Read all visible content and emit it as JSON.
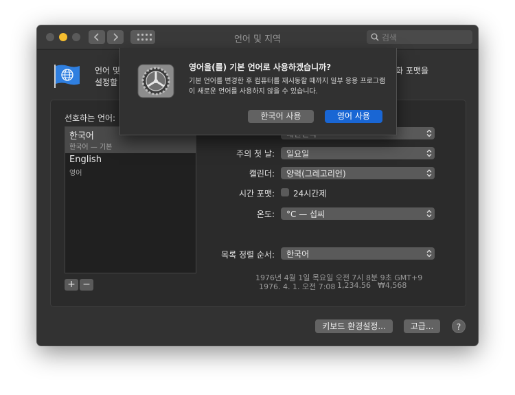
{
  "window": {
    "title": "언어 및 지역",
    "search_placeholder": "검색"
  },
  "intro": {
    "line1_left": "언어 및",
    "line1_right": "통화 포맷을",
    "line2_left": "설정할"
  },
  "preferred_languages": {
    "label": "선호하는 언어:",
    "items": [
      {
        "name": "한국어",
        "sub": "한국어 — 기본"
      },
      {
        "name": "English",
        "sub": "영어"
      }
    ],
    "add": "+",
    "remove": "−"
  },
  "settings": {
    "region_value": "대한민국",
    "first_day_label": "주의 첫 날:",
    "first_day_value": "일요일",
    "calendar_label": "캘린더:",
    "calendar_value": "양력(그레고리언)",
    "time_format_label": "시간 포맷:",
    "time_format_check": "24시간제",
    "temperature_label": "온도:",
    "temperature_value": "°C — 섭씨",
    "list_sort_label": "목록 정렬 순서:",
    "list_sort_value": "한국어"
  },
  "sample": {
    "line1": "1976년 4월 1일 목요일 오전 7시 8분 9초 GMT+9",
    "line2_date": "1976. 4. 1. 오전 7:08",
    "line2_number": "1,234.56",
    "line2_currency": "₩4,568"
  },
  "buttons": {
    "keyboard": "키보드 환경설정...",
    "advanced": "고급...",
    "help": "?"
  },
  "sheet": {
    "title": "영어을(를) 기본 언어로 사용하겠습니까?",
    "body": "기본 언어를 변경한 후 컴퓨터를 재시동할 때까지 일부 응용 프로그램이 새로운 언어를 사용하지 않을 수 있습니다.",
    "secondary_button": "한국어 사용",
    "primary_button": "영어 사용"
  },
  "colors": {
    "accent": "#1966d4",
    "window_bg": "#323232",
    "minimize": "#f6be2f"
  }
}
